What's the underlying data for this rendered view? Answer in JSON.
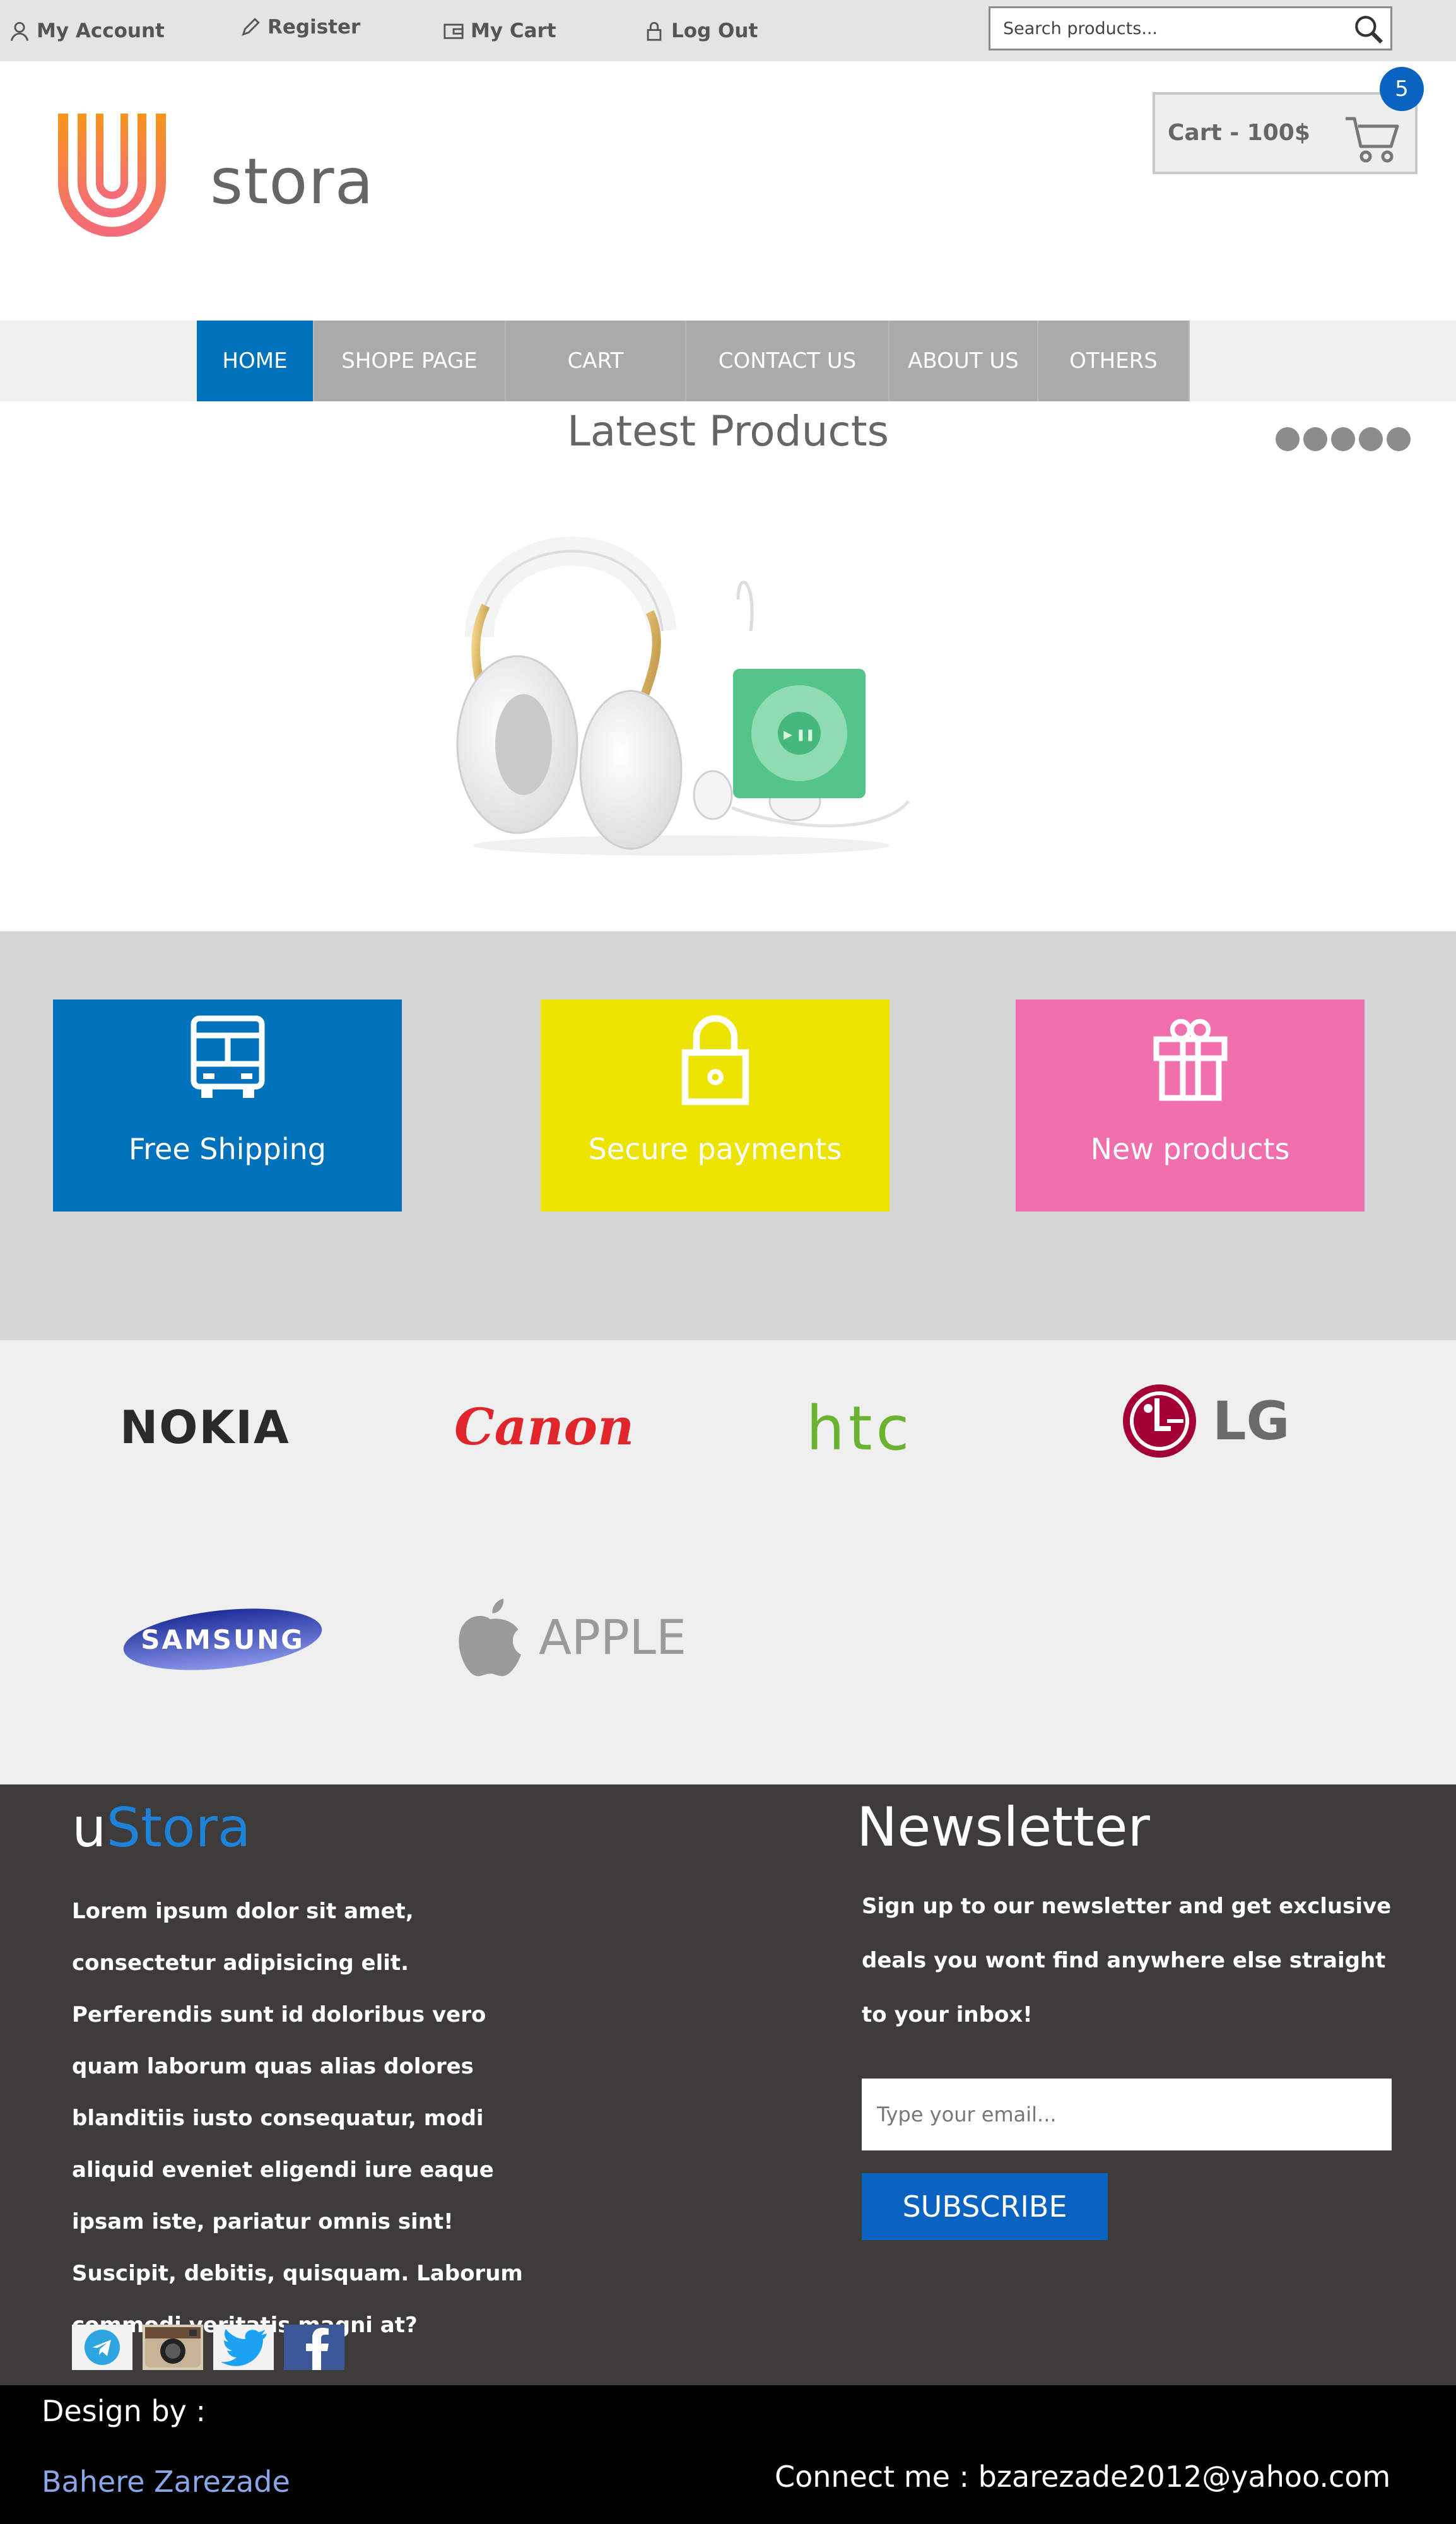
{
  "topbar": {
    "my_account": "My Account",
    "register": "Register",
    "my_cart": "My Cart",
    "log_out": "Log Out",
    "search_placeholder": "Search products..."
  },
  "header": {
    "logo_text": "stora",
    "cart_label": "Cart  - 100$",
    "cart_count": "5"
  },
  "nav": {
    "items": [
      "HOME",
      "SHOPE PAGE",
      "CART",
      "CONTACT US",
      "ABOUT US",
      "OTHERS"
    ],
    "active": "HOME"
  },
  "latest": {
    "title": "Latest Products",
    "slider_dots": 5
  },
  "features": [
    {
      "label": "Free Shipping",
      "color": "#0072bc",
      "icon": "bus-icon"
    },
    {
      "label": "Secure payments",
      "color": "#ede300",
      "icon": "lock-icon"
    },
    {
      "label": "New products",
      "color": "#f06fac",
      "icon": "gift-icon"
    }
  ],
  "brands": {
    "nokia": "NOKIA",
    "canon": "Canon",
    "htc": "htc",
    "lg": "LG",
    "samsung": "SAMSUNG",
    "apple": "APPLE"
  },
  "footer": {
    "logo_u": "u",
    "logo_stora": "Stora",
    "about": "Lorem ipsum dolor sit amet, consectetur adipisicing elit. Perferendis sunt id doloribus vero quam laborum quas alias dolores blanditiis iusto consequatur, modi aliquid eveniet eligendi iure eaque ipsam iste, pariatur omnis sint! Suscipit, debitis, quisquam. Laborum commodi veritatis magni at?",
    "newsletter_title": "Newsletter",
    "newsletter_text": "Sign up to our newsletter and get exclusive deals you wont find anywhere else straight to your inbox!",
    "email_placeholder": "Type your email...",
    "subscribe": "SUBSCRIBE",
    "socials": [
      "telegram-icon",
      "instagram-icon",
      "twitter-icon",
      "facebook-icon"
    ]
  },
  "bottom": {
    "design_by": "Design by :",
    "designer": "Bahere Zarezade",
    "connect": "Connect me : bzarezade2012@yahoo.com"
  }
}
